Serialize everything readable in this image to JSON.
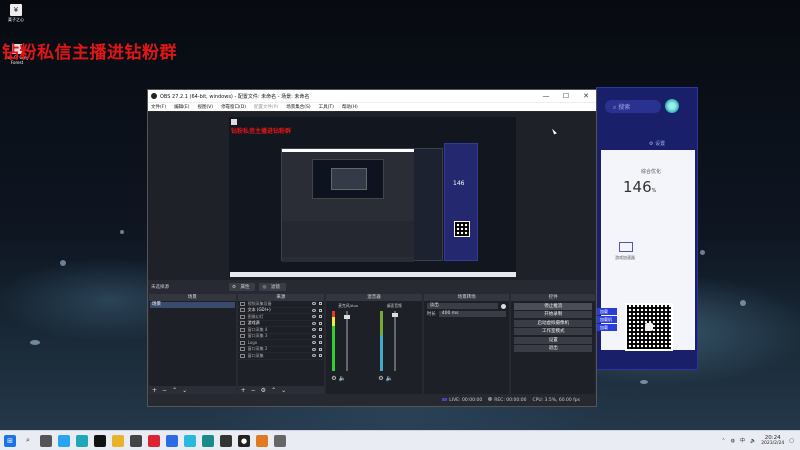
{
  "desktop": {
    "icon1_label": "栗子之心",
    "icon2_label": "Sea Of Grey Forest",
    "banner": "钻粉私信主播进钻粉群"
  },
  "side_app": {
    "search_placeholder": "搜索",
    "settings_label": "设置",
    "metric_title": "综合优化",
    "metric_value": "146",
    "metric_unit": "%",
    "feature_label": "游戏加速器",
    "side_buttons": [
      "加载",
      "加载机",
      "加载"
    ]
  },
  "obs": {
    "title": "OBS 27.2.1 (64-bit, windows) - 配置文件: 未命名 - 场景: 未命名",
    "menu": [
      "文件(F)",
      "编辑(E)",
      "视图(V)",
      "停靠窗口(D)",
      "配置文件(P)",
      "场景集合(S)",
      "工具(T)",
      "帮助(H)"
    ],
    "menu_disabled_index": 4,
    "window_buttons": [
      "—",
      "☐",
      "✕"
    ],
    "preview_banner": "钻粉私信主播进钻粉群",
    "nested_value": "146",
    "selection_status": "未选择源",
    "props_button": "属性",
    "filters_button": "滤镜",
    "docks": {
      "scenes": {
        "title": "场景",
        "items": [
          "场景"
        ]
      },
      "sources": {
        "title": "来源",
        "items": [
          {
            "name": "视频采集设备",
            "active": false
          },
          {
            "name": "文本 (GDI+)",
            "active": true
          },
          {
            "name": "图像幻灯",
            "active": false
          },
          {
            "name": "游戏源",
            "active": true
          },
          {
            "name": "窗口采集 4",
            "active": false
          },
          {
            "name": "窗口采集 3",
            "active": false
          },
          {
            "name": "Logo",
            "active": false
          },
          {
            "name": "窗口采集 2",
            "active": false
          },
          {
            "name": "窗口采集",
            "active": false
          }
        ]
      },
      "mixer": {
        "title": "混音器",
        "channels": [
          "麦克风/Aux",
          "桌面音频"
        ]
      },
      "transitions": {
        "title": "场景转场",
        "type": "淡出",
        "duration_label": "时长",
        "duration_value": "400 ms"
      },
      "controls": {
        "title": "控件",
        "buttons": [
          "停止推流",
          "开始录制",
          "启动虚拟摄像机",
          "工作室模式",
          "设置",
          "退出"
        ]
      }
    },
    "statusbar": {
      "live_label": "LIVE:",
      "live_time": "00:00:00",
      "rec_label": "REC:",
      "rec_time": "00:00:00",
      "cpu": "CPU: 3.5%, 60.00 fps"
    }
  },
  "taskbar": {
    "time": "20:24",
    "date": "2023/2/24",
    "tray_lang": "中",
    "app_icons": [
      "start",
      "search",
      "task-view",
      "widgets",
      "edge",
      "qq",
      "file-explorer",
      "store",
      "netease-music",
      "app-blue",
      "app-cyan",
      "app-teal",
      "app-dark",
      "obs",
      "app-orange",
      "app-gray"
    ]
  },
  "colors": {
    "banner": "#e01616",
    "side_app_bg": "#1a1f6a",
    "obs_bg": "#272a33",
    "taskbar_bg": "#e9edf3"
  }
}
